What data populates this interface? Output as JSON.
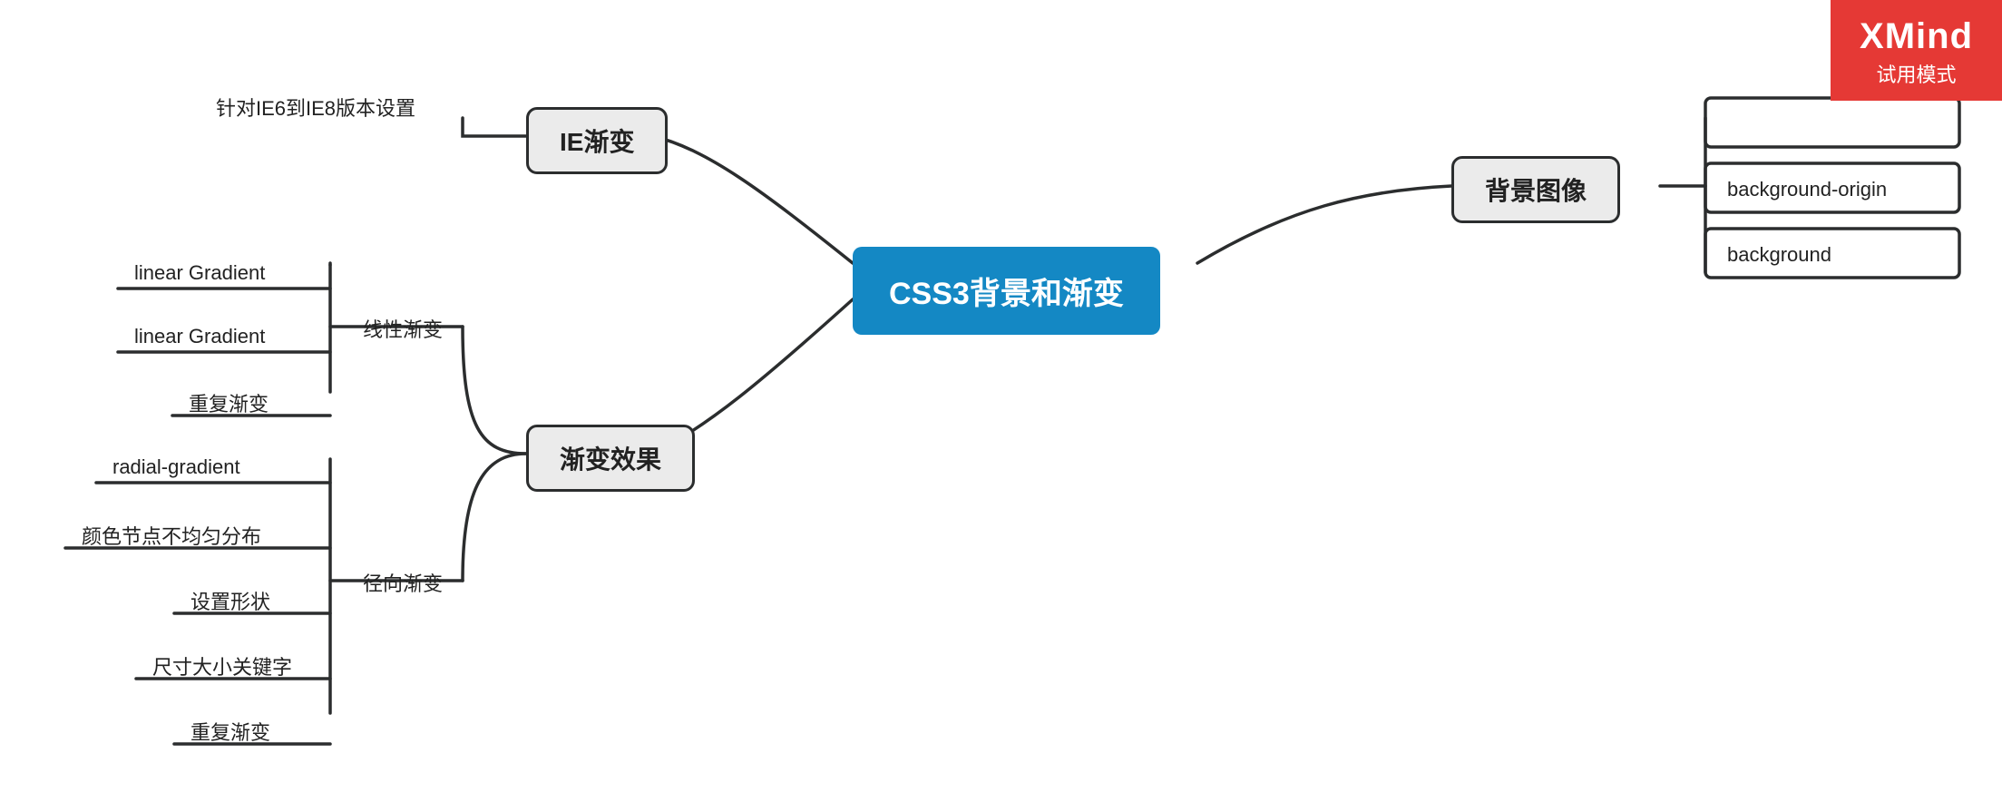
{
  "badge": {
    "brand": "XMind",
    "mode": "试用模式"
  },
  "root": "CSS3背景和渐变",
  "branches": {
    "ie": {
      "label": "IE渐变",
      "leaves": [
        "针对IE6到IE8版本设置"
      ]
    },
    "bg": {
      "label": "背景图像",
      "leaves": [
        "background-origin",
        "background"
      ]
    },
    "grad": {
      "label": "渐变效果",
      "groups": {
        "linear": {
          "label": "线性渐变",
          "leaves": [
            "linear Gradient",
            "linear Gradient",
            "重复渐变"
          ]
        },
        "radial": {
          "label": "径向渐变",
          "leaves": [
            "radial-gradient",
            "颜色节点不均匀分布",
            "设置形状",
            "尺寸大小关键字",
            "重复渐变"
          ]
        }
      }
    }
  }
}
